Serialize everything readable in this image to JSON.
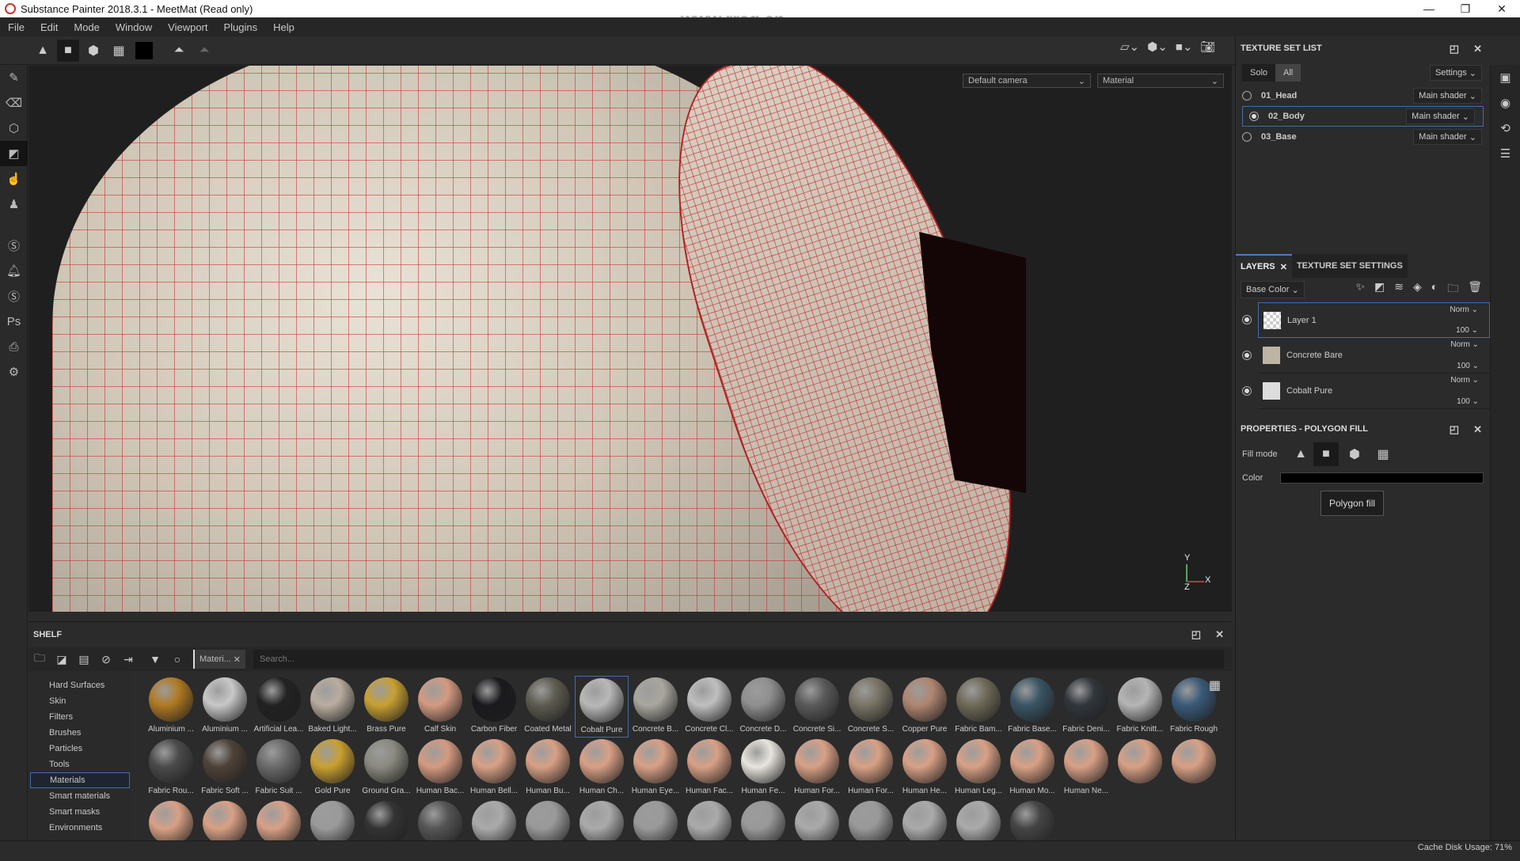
{
  "window": {
    "title": "Substance Painter 2018.3.1 - MeetMat (Read only)",
    "minimize": "—",
    "maximize": "❐",
    "close": "✕"
  },
  "watermark": "www.rrcg.cn",
  "menu": [
    "File",
    "Edit",
    "Mode",
    "Window",
    "Viewport",
    "Plugins",
    "Help"
  ],
  "toolbar": {
    "tools": [
      "symmetry-triangle",
      "polygon-fill-square",
      "mesh-cube",
      "uv-checker",
      "color-swatch",
      "mirror",
      "mirror-alt"
    ]
  },
  "left_tools": [
    "paint-brush",
    "eraser",
    "projection",
    "polygon-fill",
    "smudge",
    "clone-stamp",
    "substance",
    "bell",
    "substance-alt",
    "photoshop",
    "export",
    "settings"
  ],
  "viewport": {
    "camera": "Default camera",
    "mode": "Material",
    "axes": {
      "y": "Y",
      "x": "X",
      "z": "Z"
    }
  },
  "texture_set_list": {
    "title": "TEXTURE SET LIST",
    "solo": "Solo",
    "all": "All",
    "settings": "Settings",
    "sets": [
      {
        "name": "01_Head",
        "shader": "Main shader",
        "selected": false
      },
      {
        "name": "02_Body",
        "shader": "Main shader",
        "selected": true
      },
      {
        "name": "03_Base",
        "shader": "Main shader",
        "selected": false
      }
    ]
  },
  "layers": {
    "tab_layers": "LAYERS",
    "tab_tss": "TEXTURE SET SETTINGS",
    "channel": "Base Color",
    "items": [
      {
        "name": "Layer 1",
        "blend": "Norm",
        "opacity": "100",
        "selected": true
      },
      {
        "name": "Concrete Bare",
        "blend": "Norm",
        "opacity": "100",
        "selected": false
      },
      {
        "name": "Cobalt Pure",
        "blend": "Norm",
        "opacity": "100",
        "selected": false
      }
    ]
  },
  "properties": {
    "title": "PROPERTIES - POLYGON FILL",
    "fill_mode": "Fill mode",
    "color": "Color",
    "tooltip": "Polygon fill",
    "color_value": "#000000"
  },
  "shelf": {
    "title": "SHELF",
    "filter_chip": "Materi...",
    "search_placeholder": "Search...",
    "categories": [
      "Hard Surfaces",
      "Skin",
      "Filters",
      "Brushes",
      "Particles",
      "Tools",
      "Materials",
      "Smart materials",
      "Smart masks",
      "Environments"
    ],
    "selected_category": "Materials",
    "materials": [
      {
        "name": "Aluminium ...",
        "color": "#b07a22"
      },
      {
        "name": "Aluminium ...",
        "color": "#c8c8c8"
      },
      {
        "name": "Artificial Lea...",
        "color": "#222"
      },
      {
        "name": "Baked Light...",
        "color": "#b9ada0"
      },
      {
        "name": "Brass Pure",
        "color": "#c8a032"
      },
      {
        "name": "Calf Skin",
        "color": "#d49a80"
      },
      {
        "name": "Carbon Fiber",
        "color": "#1a1a1e"
      },
      {
        "name": "Coated Metal",
        "color": "#5e5c50"
      },
      {
        "name": "Cobalt Pure",
        "color": "#b8b8b8",
        "selected": true
      },
      {
        "name": "Concrete B...",
        "color": "#a9a69e"
      },
      {
        "name": "Concrete Cl...",
        "color": "#bfbfbf"
      },
      {
        "name": "Concrete D...",
        "color": "#8f8f8f"
      },
      {
        "name": "Concrete Si...",
        "color": "#5a5a5a"
      },
      {
        "name": "Concrete S...",
        "color": "#7a7466"
      },
      {
        "name": "Copper Pure",
        "color": "#b08570"
      },
      {
        "name": "Fabric Bam...",
        "color": "#6e6a58"
      },
      {
        "name": "Fabric Base...",
        "color": "#3a5565"
      },
      {
        "name": "Fabric Deni...",
        "color": "#30363c"
      },
      {
        "name": "Fabric Knitt...",
        "color": "#b5b5b5"
      },
      {
        "name": "Fabric Rough",
        "color": "#3a5a78"
      },
      {
        "name": "Fabric Rou...",
        "color": "#4a4a4a"
      },
      {
        "name": "Fabric Soft ...",
        "color": "#4e4238"
      },
      {
        "name": "Fabric Suit ...",
        "color": "#6a6a6a"
      },
      {
        "name": "Gold Pure",
        "color": "#c9a030"
      },
      {
        "name": "Ground Gra...",
        "color": "#8a8a80"
      },
      {
        "name": "Human Bac...",
        "color": "#d59a80"
      },
      {
        "name": "Human Bell...",
        "color": "#d8a085"
      },
      {
        "name": "Human Bu...",
        "color": "#d8a085"
      },
      {
        "name": "Human Ch...",
        "color": "#d8a085"
      },
      {
        "name": "Human Eye...",
        "color": "#d8a085"
      },
      {
        "name": "Human Fac...",
        "color": "#d8a085"
      },
      {
        "name": "Human Fe...",
        "color": "#e8e4de"
      },
      {
        "name": "Human For...",
        "color": "#d8a085"
      },
      {
        "name": "Human For...",
        "color": "#d8a085"
      },
      {
        "name": "Human He...",
        "color": "#d8a085"
      },
      {
        "name": "Human Leg...",
        "color": "#d8a085"
      },
      {
        "name": "Human Mo...",
        "color": "#d8a085"
      },
      {
        "name": "Human Ne...",
        "color": "#d8a085"
      },
      {
        "name": "",
        "color": "#d8a085"
      },
      {
        "name": "",
        "color": "#d8a085"
      },
      {
        "name": "",
        "color": "#d8a085"
      },
      {
        "name": "",
        "color": "#d8a085"
      },
      {
        "name": "",
        "color": "#d8a085"
      },
      {
        "name": "",
        "color": "#9a9a9a"
      },
      {
        "name": "",
        "color": "#333"
      },
      {
        "name": "",
        "color": "#555"
      },
      {
        "name": "",
        "color": "#aaa"
      },
      {
        "name": "",
        "color": "#999"
      },
      {
        "name": "",
        "color": "#aaa"
      },
      {
        "name": "",
        "color": "#999"
      },
      {
        "name": "",
        "color": "#aaa"
      },
      {
        "name": "",
        "color": "#999"
      },
      {
        "name": "",
        "color": "#aaa"
      },
      {
        "name": "",
        "color": "#999"
      },
      {
        "name": "",
        "color": "#aaa"
      },
      {
        "name": "",
        "color": "#aaa"
      },
      {
        "name": "",
        "color": "#444"
      }
    ]
  },
  "status": {
    "cache": "Cache Disk Usage:   71%"
  }
}
